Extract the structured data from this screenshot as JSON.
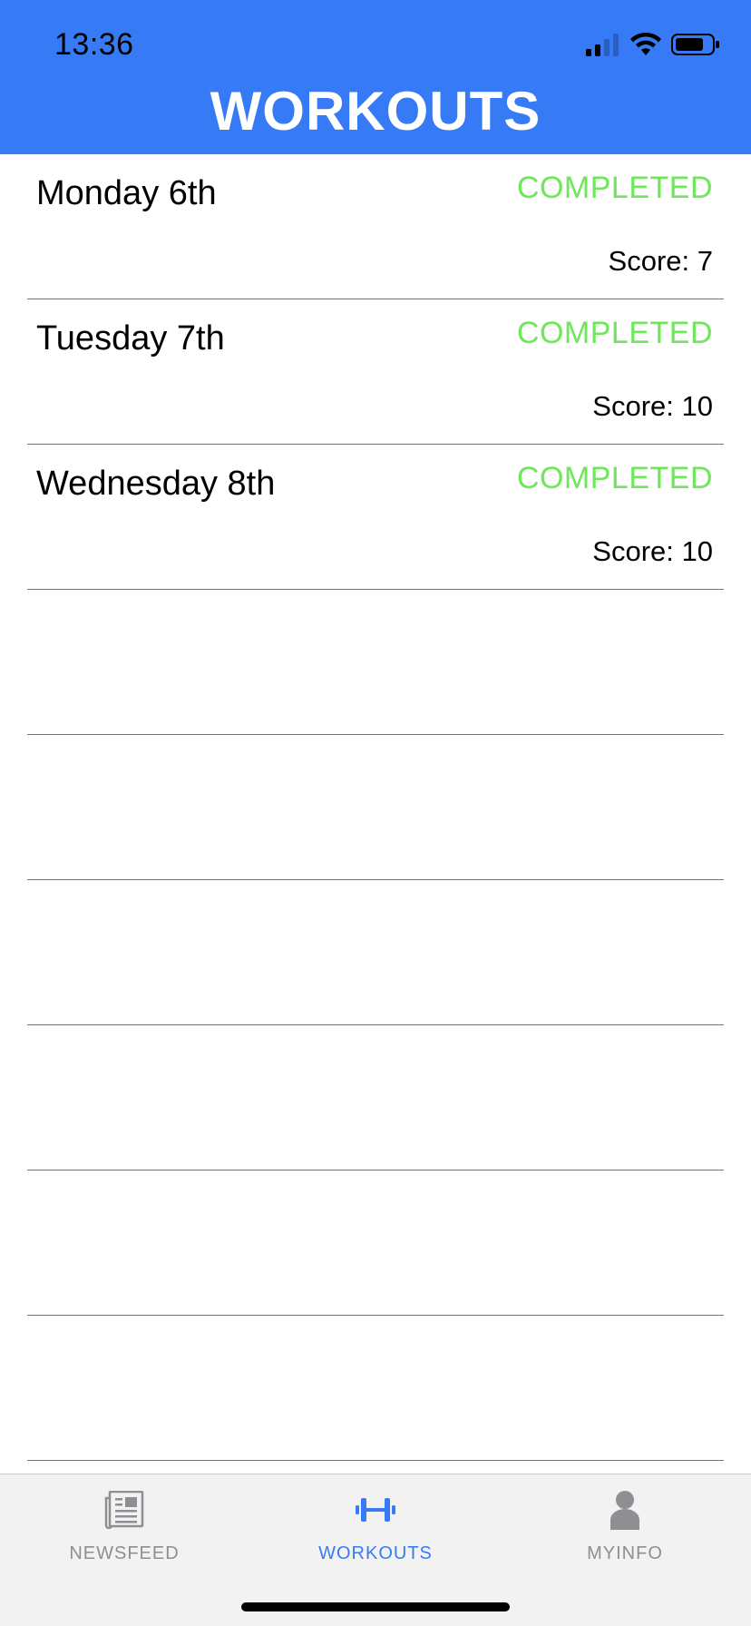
{
  "status_bar": {
    "time": "13:36"
  },
  "header": {
    "title": "WORKOUTS",
    "background_color": "#367bf5"
  },
  "workouts": [
    {
      "day": "Monday 6th",
      "status": "COMPLETED",
      "score": "Score: 7"
    },
    {
      "day": "Tuesday 7th",
      "status": "COMPLETED",
      "score": "Score: 10"
    },
    {
      "day": "Wednesday 8th",
      "status": "COMPLETED",
      "score": "Score: 10"
    },
    {
      "day": "",
      "status": "",
      "score": ""
    },
    {
      "day": "",
      "status": "",
      "score": ""
    },
    {
      "day": "",
      "status": "",
      "score": ""
    },
    {
      "day": "",
      "status": "",
      "score": ""
    },
    {
      "day": "",
      "status": "",
      "score": ""
    },
    {
      "day": "",
      "status": "",
      "score": ""
    }
  ],
  "colors": {
    "completed": "#6ee85a",
    "divider": "#3a7be8",
    "tab_active": "#367bf5",
    "tab_inactive": "#8e8e93"
  },
  "tab_bar": {
    "tabs": [
      {
        "label": "NEWSFEED",
        "icon": "newspaper-icon",
        "active": false
      },
      {
        "label": "WORKOUTS",
        "icon": "dumbbell-icon",
        "active": true
      },
      {
        "label": "MYINFO",
        "icon": "person-icon",
        "active": false
      }
    ]
  }
}
